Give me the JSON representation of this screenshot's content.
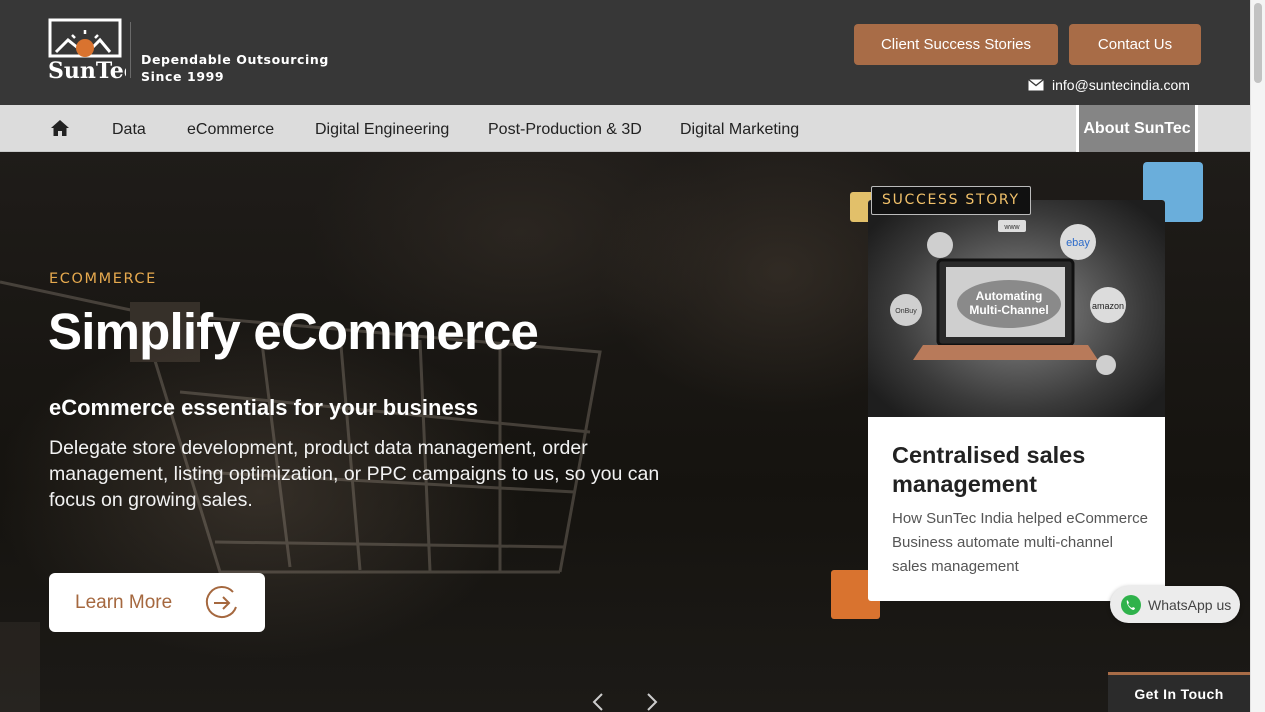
{
  "header": {
    "logo_alt": "SunTec",
    "tagline_line1": "Dependable Outsourcing",
    "tagline_line2": "Since 1999",
    "btn_stories": "Client Success Stories",
    "btn_contact": "Contact Us",
    "email": "info@suntecindia.com"
  },
  "nav": {
    "items": [
      "Data",
      "eCommerce",
      "Digital Engineering",
      "Post-Production & 3D",
      "Digital Marketing"
    ],
    "about": "About SunTec"
  },
  "hero": {
    "eyebrow": "ECOMMERCE",
    "title": "Simplify eCommerce",
    "subtitle": "eCommerce essentials for your business",
    "description": "Delegate store development, product data management, order management, listing optimization, or PPC campaigns to us, so you can focus on growing sales.",
    "cta": "Learn More"
  },
  "card": {
    "badge": "SUCCESS STORY",
    "image_caption_line1": "Automating",
    "image_caption_line2": "Multi-Channel",
    "image_logos": [
      "ebay",
      "amazon",
      "OnBuy",
      "www"
    ],
    "title": "Centralised sales management",
    "description": "How SunTec India helped eCommerce Business automate multi-channel sales management"
  },
  "floating": {
    "whatsapp": "WhatsApp us",
    "get_in_touch": "Get In Touch"
  },
  "colors": {
    "header_bg": "#373737",
    "brand_brown": "#a86c47",
    "accent_gold": "#e6a94e",
    "nav_bg": "#dcdcdc"
  }
}
